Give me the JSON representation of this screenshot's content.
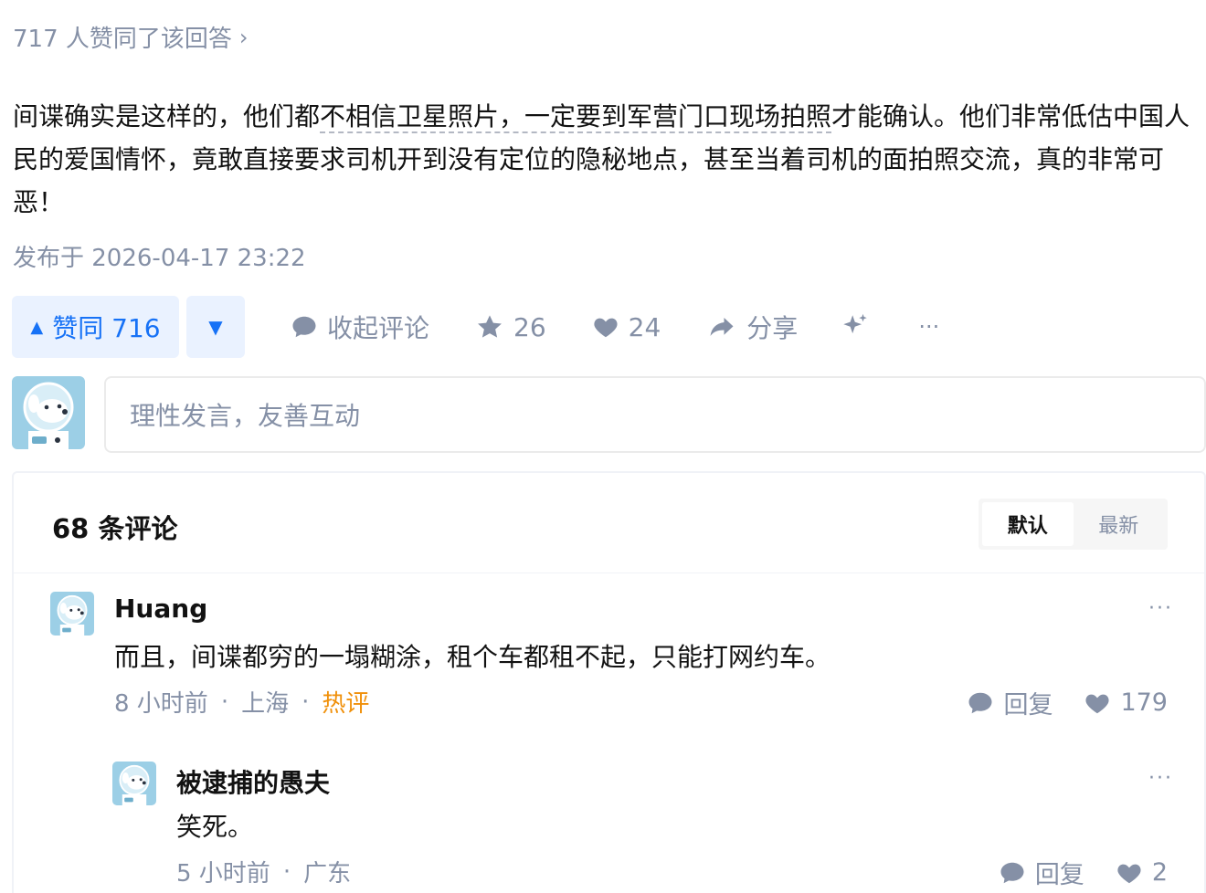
{
  "answer": {
    "upvote_summary": "717 人赞同了该回答",
    "content_part1": "间谍确实是这样的，他们都",
    "content_highlight": "不相信卫星照片，一定要到军营门口现场拍照",
    "content_part2": "才能确认。他们非常低估中国人民的爱国情怀，竟敢直接要求司机开到没有定位的隐秘地点，甚至当着司机的面拍照交流，真的非常可恶！",
    "published": "发布于 2026-04-17 23:22"
  },
  "actions": {
    "upvote_label": "赞同 716",
    "comment_label": "收起评论",
    "favorite_count": "26",
    "like_count": "24",
    "share_label": "分享",
    "more_label": "···"
  },
  "composer": {
    "placeholder": "理性发言，友善互动"
  },
  "comments": {
    "count_label": "68 条评论",
    "sort_default": "默认",
    "sort_latest": "最新",
    "items": [
      {
        "author": "Huang",
        "text": "而且，间谍都穷的一塌糊涂，租个车都租不起，只能打网约车。",
        "time": "8 小时前",
        "location": "上海",
        "tag": "热评",
        "reply_label": "回复",
        "likes": "179"
      },
      {
        "author": "被逮捕的愚夫",
        "text": "笑死。",
        "time": "5 小时前",
        "location": "广东",
        "reply_label": "回复",
        "likes": "2"
      }
    ]
  },
  "colors": {
    "primary": "#1772f6",
    "muted": "#8590a6",
    "hot": "#f0900a"
  }
}
